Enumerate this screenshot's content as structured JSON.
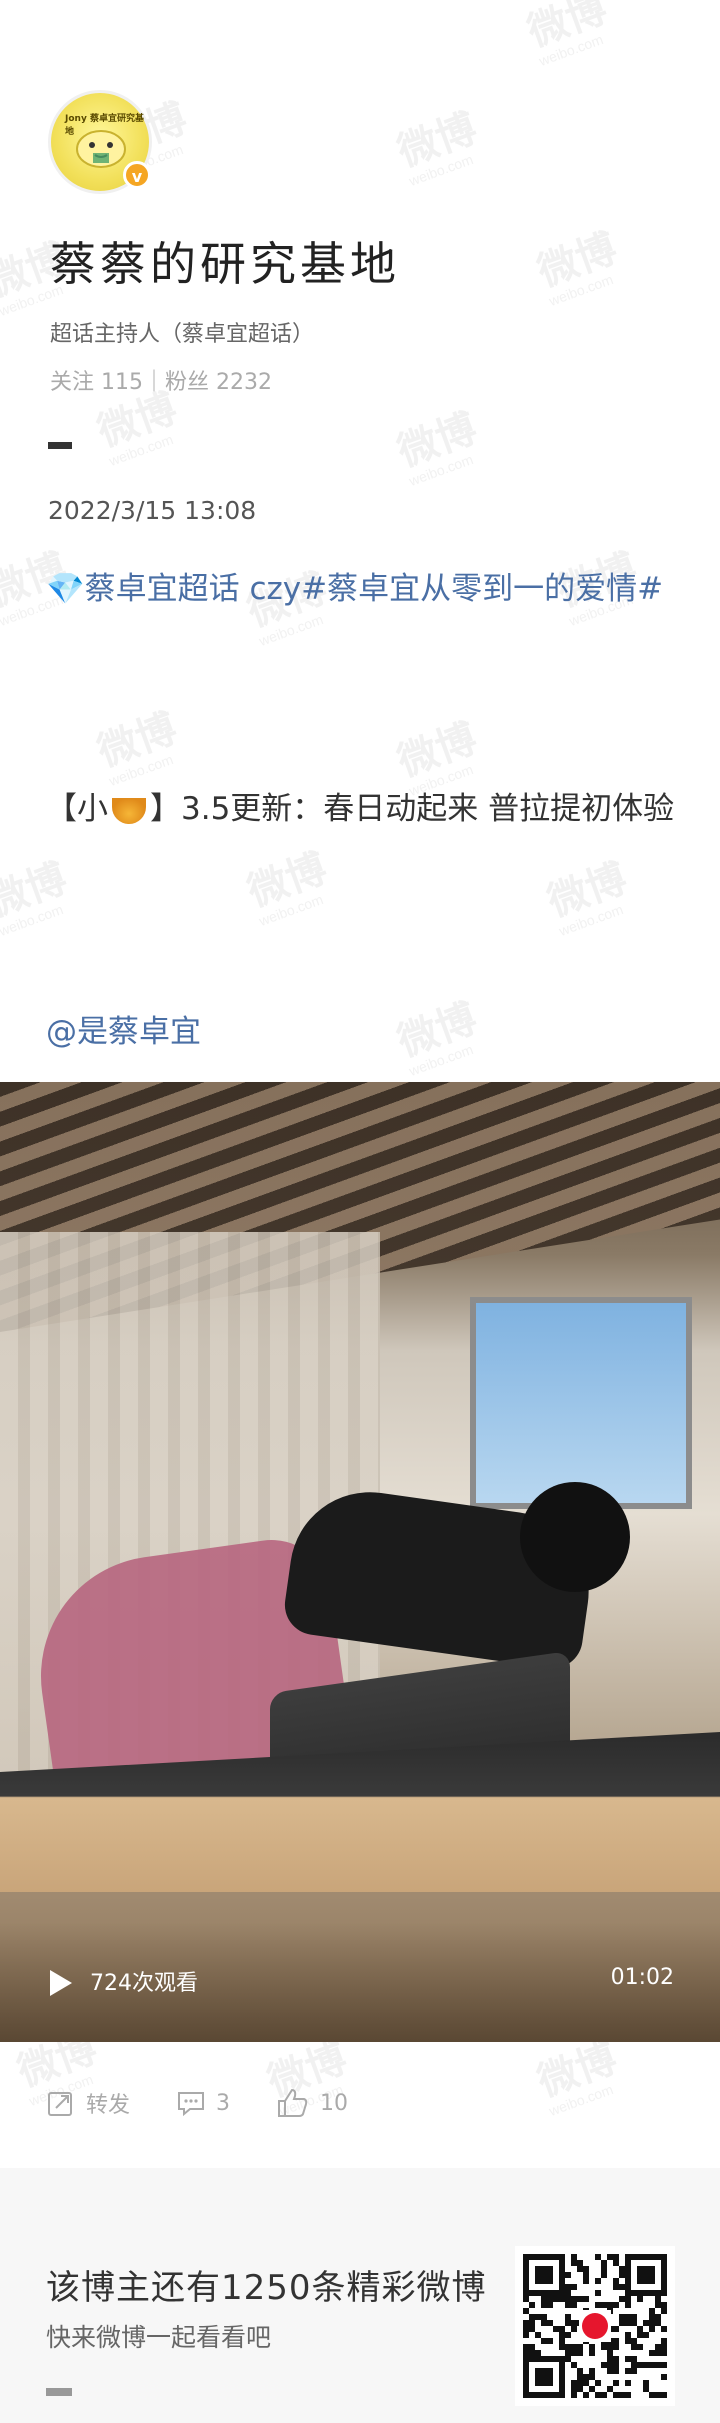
{
  "profile": {
    "avatar_text": "Jony 蔡卓宜研究基地",
    "verified_badge": "v",
    "name": "蔡蔡的研究基地",
    "role": "超话主持人（蔡卓宜超话）",
    "stats": "关注 115｜粉丝 2232"
  },
  "post": {
    "date": "2022/3/15 13:08",
    "topic_line": "💎蔡卓宜超话 czy#蔡卓宜从零到一的爱情#",
    "body_prefix": "【小",
    "body_suffix": "】3.5更新：春日动起来 普拉提初体验",
    "mention": "@是蔡卓宜"
  },
  "video": {
    "views": "724次观看",
    "duration": "01:02"
  },
  "actions": {
    "repost": "转发",
    "comment_count": "3",
    "like_count": "10"
  },
  "footer": {
    "title": "该博主还有1250条精彩微博",
    "subtitle": "快来微博一起看看吧"
  },
  "watermark": {
    "text": "微博",
    "sub": "weibo.com"
  },
  "colors": {
    "link": "#4a6fa5",
    "badge": "#f5a623"
  }
}
